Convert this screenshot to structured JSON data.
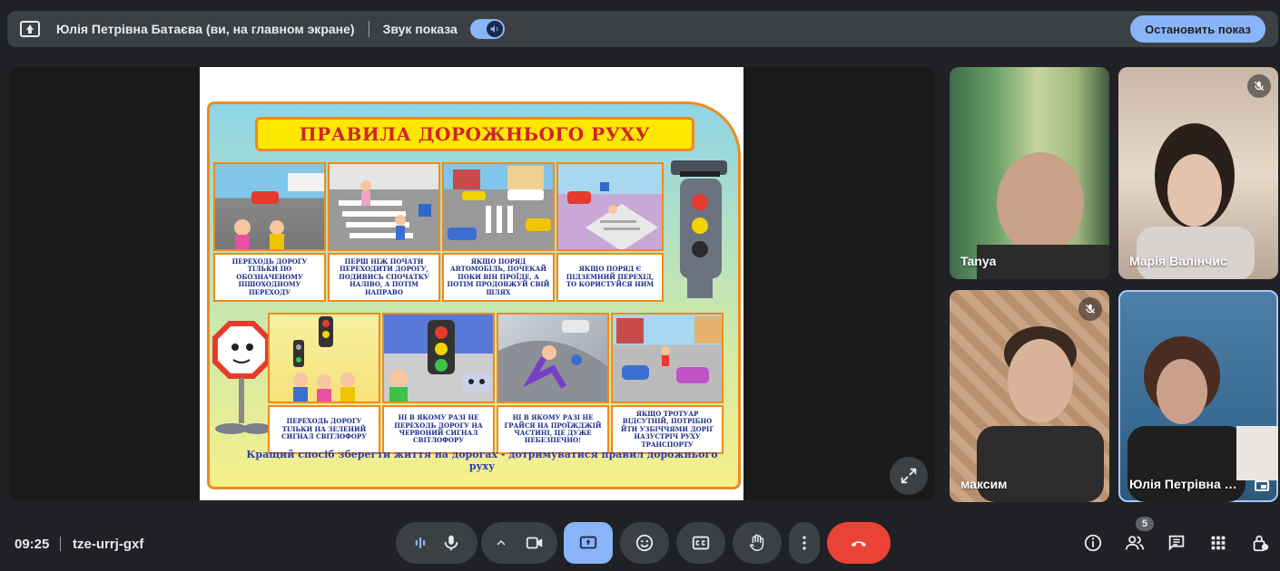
{
  "present_bar": {
    "presenter": "Юлія Петрівна Батаєва (ви, на главном экране)",
    "sound_label": "Звук показа",
    "sound_on": true,
    "stop_label": "Остановить показ"
  },
  "slide": {
    "title": "ПРАВИЛА ДОРОЖНЬОГО РУХУ",
    "captions": [
      "ПЕРЕХОДЬ ДОРОГУ ТІЛЬКИ ПО ОБОЗНАЧЕНОМУ ПІШОХОДНОМУ ПЕРЕХОДУ",
      "ПЕРШ НІЖ ПОЧАТИ ПЕРЕХОДИТИ ДОРОГУ, ПОДИВИСЬ СПОЧАТКУ НАЛІВО, А ПОТІМ НАПРАВО",
      "ЯКЩО ПОРЯД АВТОМОБІЛЬ, ПОЧЕКАЙ ПОКИ ВІН ПРОЇДЕ, А ПОТІМ ПРОДОВЖУЙ СВІЙ ШЛЯХ",
      "ЯКЩО ПОРЯД Є ПІДЗЕМНИЙ ПЕРЕХІД, ТО КОРИСТУЙСЯ НИМ",
      "ПЕРЕХОДЬ ДОРОГУ ТІЛЬКИ НА ЗЕЛЕНИЙ СИГНАЛ СВІТЛОФОРУ",
      "НІ В ЯКОМУ РАЗІ НЕ ПЕРЕХОДЬ ДОРОГУ НА ЧЕРВОНИЙ СИГНАЛ СВІТЛОФОРУ",
      "НІ В ЯКОМУ РАЗІ НЕ ГРАЙСЯ НА ПРОЇЖДЖІЙ ЧАСТИНІ, ЦЕ ДУЖЕ НЕБЕЗПЕЧНО!",
      "ЯКЩО ТРОТУАР ВІДСУТНІЙ, ПОТРІБНО ЙТИ УЗБІЧЧЯМИ ДОРІГ НАЗУСТРІЧ РУХУ ТРАНСПОРТУ"
    ],
    "footer": "Кращий спосіб зберегти життя на дорогах - дотримуватися правил дорожнього руху"
  },
  "participants": [
    {
      "name": "Tanya",
      "muted": false
    },
    {
      "name": "Марія Валінчис",
      "muted": true
    },
    {
      "name": "максим",
      "muted": true
    },
    {
      "name": "Юлія Петрівна Батаєва",
      "muted": false
    }
  ],
  "bottom": {
    "time": "09:25",
    "meeting_code": "tze-urrj-gxf",
    "participants_count": "5"
  },
  "colors": {
    "accent": "#8ab4f8",
    "bar": "#3c4043",
    "background": "#202124",
    "end_call": "#ea4335"
  }
}
